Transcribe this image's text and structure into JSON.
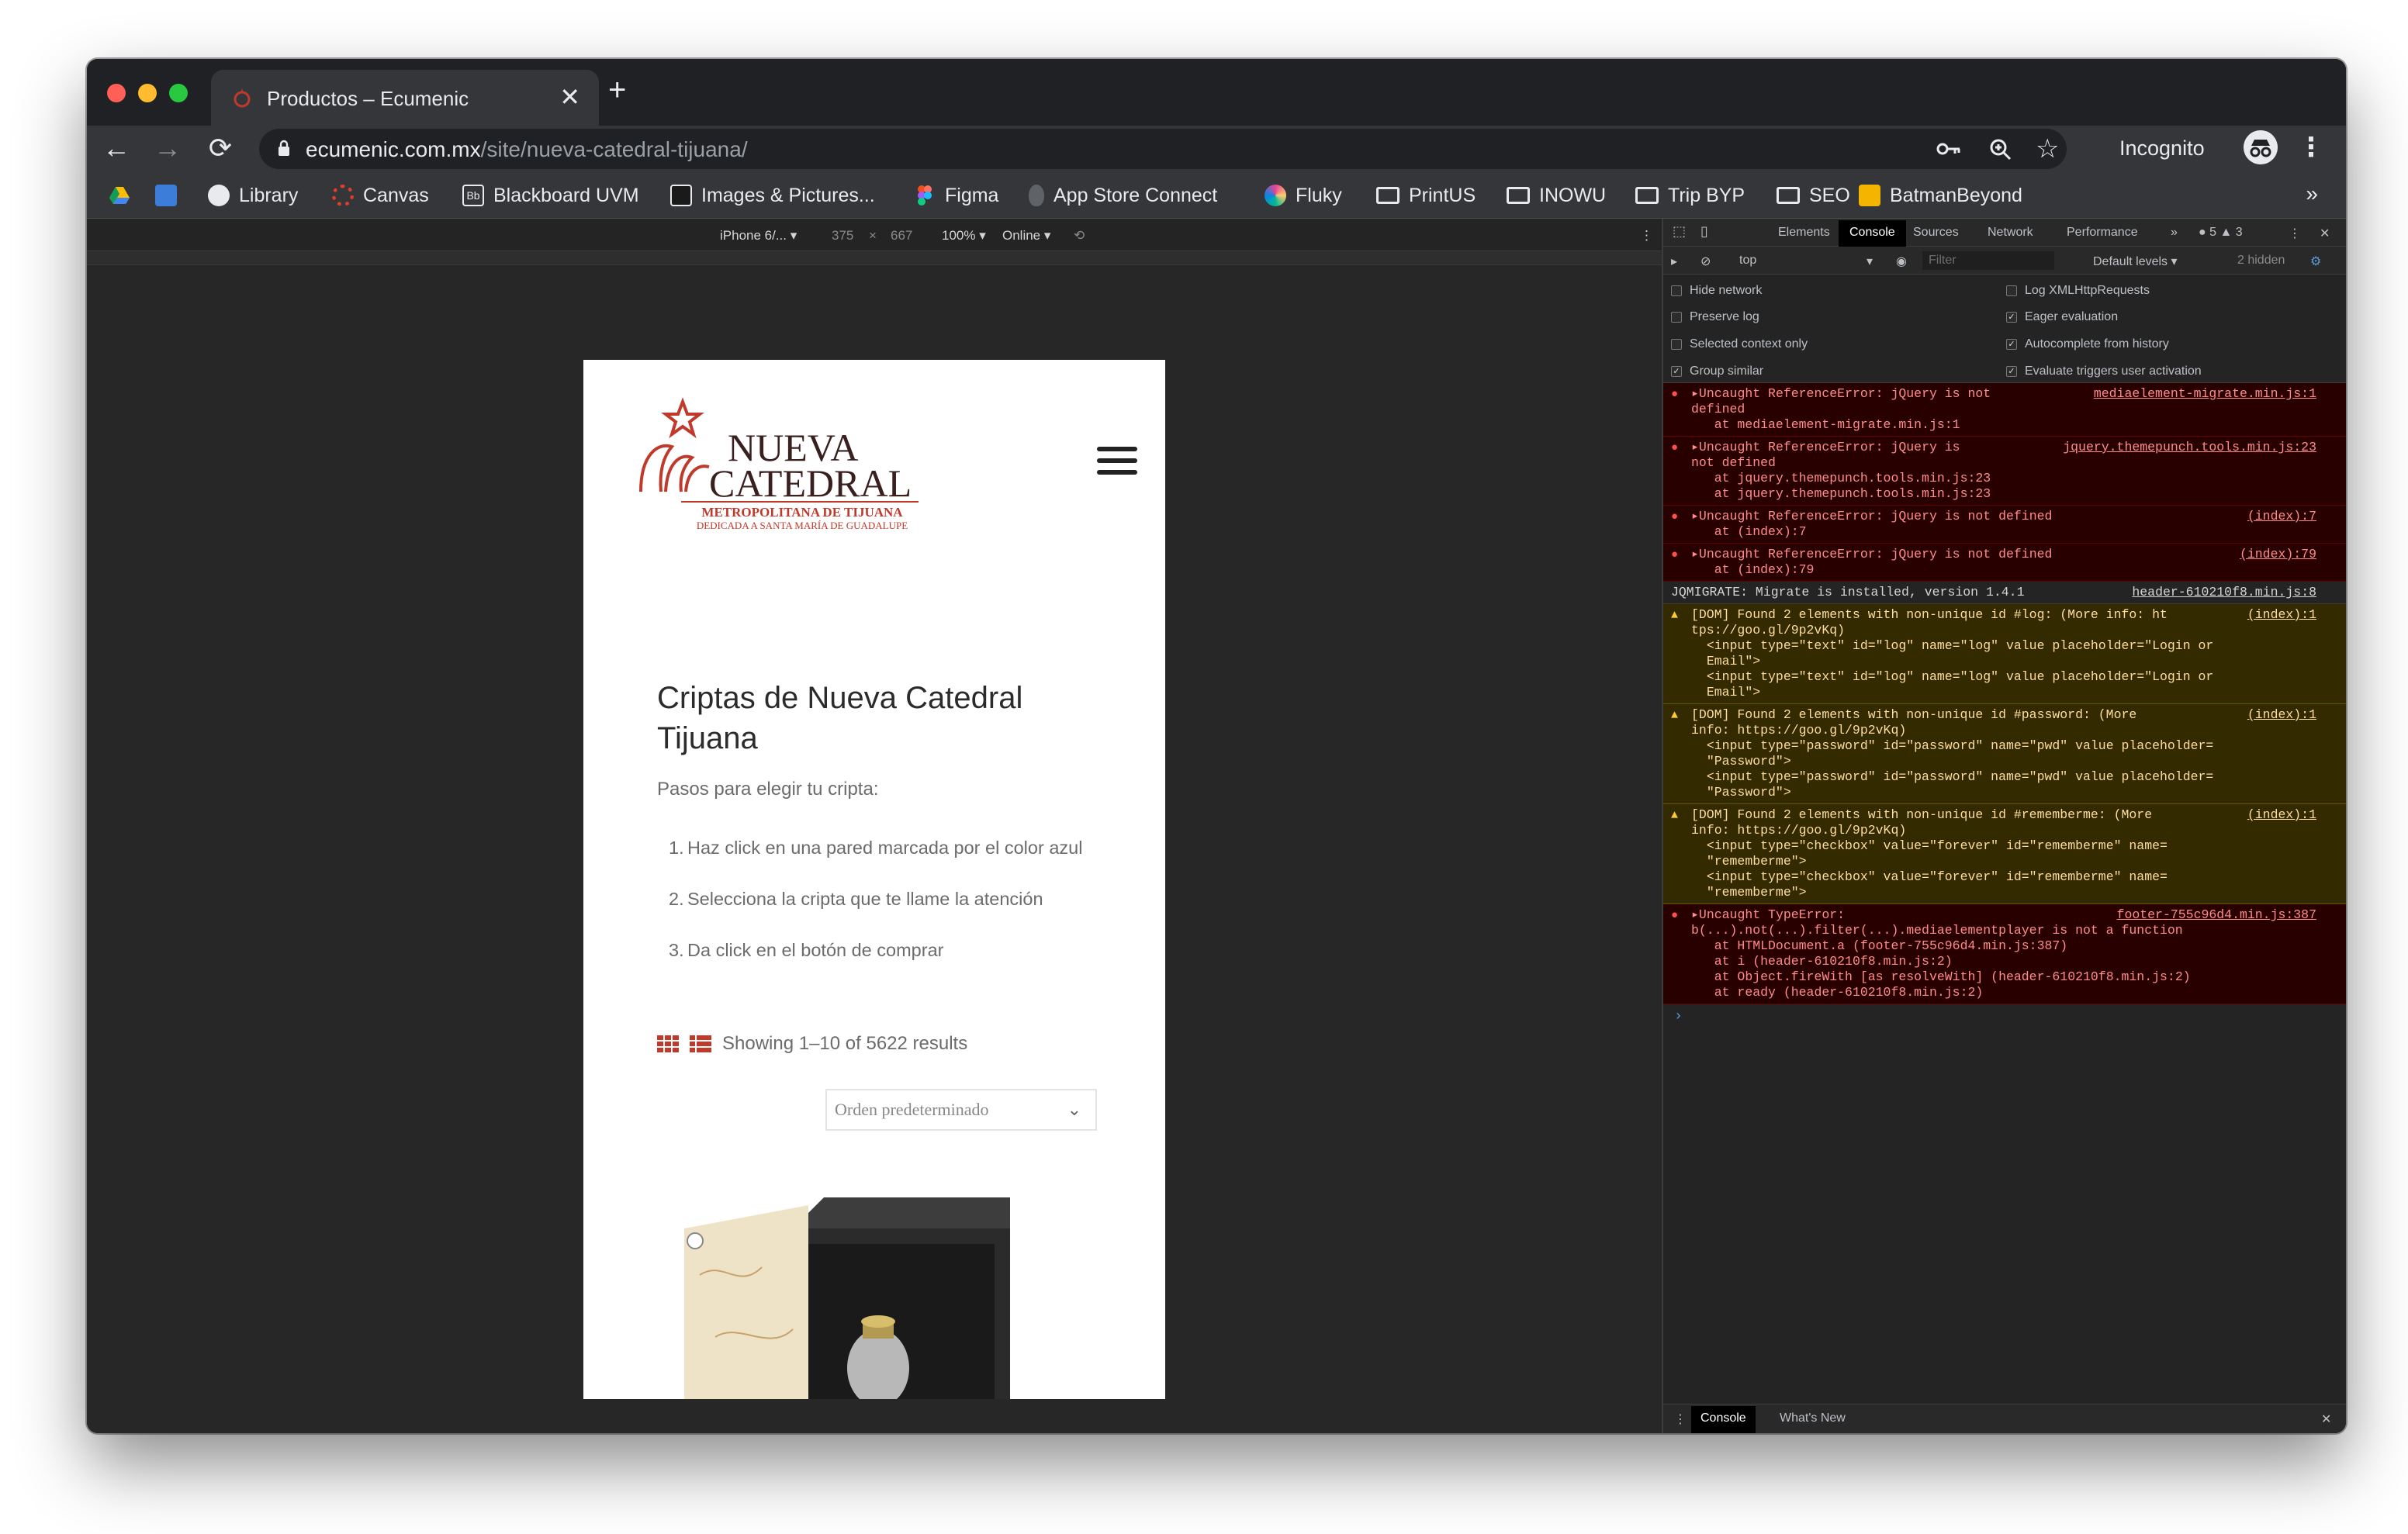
{
  "browser": {
    "tab": {
      "title": "Productos – Ecumenic",
      "close": "✕"
    },
    "new_tab": "+",
    "url_host": "ecumenic.com.mx",
    "url_path": "/site/nueva-catedral-tijuana/",
    "incognito_label": "Incognito",
    "bookmarks": [
      {
        "label": "",
        "icon": "google-drive-icon"
      },
      {
        "label": "",
        "icon": "blue-app-icon"
      },
      {
        "label": "Library",
        "icon": "globe-icon"
      },
      {
        "label": "Canvas",
        "icon": "canvas-icon"
      },
      {
        "label": "Blackboard UVM",
        "icon": "blackboard-icon"
      },
      {
        "label": "Images & Pictures...",
        "icon": "images-icon"
      },
      {
        "label": "Figma",
        "icon": "figma-icon"
      },
      {
        "label": "App Store Connect",
        "icon": "apple-icon"
      },
      {
        "label": "Fluky",
        "icon": "fluky-icon"
      },
      {
        "label": "PrintUS",
        "icon": "folder-icon"
      },
      {
        "label": "INOWU",
        "icon": "folder-icon"
      },
      {
        "label": "Trip BYP",
        "icon": "folder-icon"
      },
      {
        "label": "SEO",
        "icon": "folder-icon"
      },
      {
        "label": "BatmanBeyond",
        "icon": "batman-icon"
      }
    ],
    "bookmarks_more": "»"
  },
  "device_toolbar": {
    "device": "iPhone 6/... ▾",
    "width": "375",
    "times": "×",
    "height": "667",
    "zoom": "100% ▾",
    "network": "Online ▾"
  },
  "page": {
    "logo_title": "NUEVA CATEDRAL",
    "logo_sub1": "METROPOLITANA DE TIJUANA",
    "logo_sub2": "DEDICADA A SANTA MARÍA DE GUADALUPE",
    "heading": "Criptas de Nueva Catedral Tijuana",
    "intro": "Pasos para elegir tu cripta:",
    "steps": [
      {
        "num": "1.",
        "text": "Haz click en una pared marcada por el color azul"
      },
      {
        "num": "2.",
        "text": "Selecciona la cripta que te llame la atención"
      },
      {
        "num": "3.",
        "text": "Da click en el botón de comprar"
      }
    ],
    "results": "Showing 1–10 of 5622 results",
    "sort_value": "Orden predeterminado",
    "sort_caret": "⌄"
  },
  "devtools": {
    "tabs": [
      "Elements",
      "Console",
      "Sources",
      "Network",
      "Performance"
    ],
    "more": "»",
    "counts": "● 5 ▲ 3",
    "context": "top",
    "filter_placeholder": "Filter",
    "levels": "Default levels ▾",
    "hidden": "2 hidden",
    "settings_left": [
      {
        "label": "Hide network",
        "checked": false
      },
      {
        "label": "Preserve log",
        "checked": false
      },
      {
        "label": "Selected context only",
        "checked": false
      },
      {
        "label": "Group similar",
        "checked": true
      }
    ],
    "settings_right": [
      {
        "label": "Log XMLHttpRequests",
        "checked": false
      },
      {
        "label": "Eager evaluation",
        "checked": true
      },
      {
        "label": "Autocomplete from history",
        "checked": true
      },
      {
        "label": "Evaluate triggers user activation",
        "checked": true
      }
    ],
    "log": [
      {
        "level": "err",
        "msg": "▸Uncaught ReferenceError: jQuery is not\ndefined\n   at mediaelement-migrate.min.js:1",
        "src": "mediaelement-migrate.min.js:1"
      },
      {
        "level": "err",
        "msg": "▸Uncaught ReferenceError: jQuery is\nnot defined\n   at jquery.themepunch.tools.min.js:23\n   at jquery.themepunch.tools.min.js:23",
        "src": "jquery.themepunch.tools.min.js:23"
      },
      {
        "level": "err",
        "msg": "▸Uncaught ReferenceError: jQuery is not defined\n   at (index):7",
        "src": "(index):7"
      },
      {
        "level": "err",
        "msg": "▸Uncaught ReferenceError: jQuery is not defined\n   at (index):79",
        "src": "(index):79"
      },
      {
        "level": "info",
        "msg": "JQMIGRATE: Migrate is installed, version 1.4.1",
        "src": "header-610210f8.min.js:8"
      },
      {
        "level": "warn",
        "msg": "[DOM] Found 2 elements with non-unique id #log: (More info: ht\ntps://goo.gl/9p2vKq)\n  <input type=\"text\" id=\"log\" name=\"log\" value placeholder=\"Login or\n  Email\">\n  <input type=\"text\" id=\"log\" name=\"log\" value placeholder=\"Login or\n  Email\">",
        "src": "(index):1"
      },
      {
        "level": "warn",
        "msg": "[DOM] Found 2 elements with non-unique id #password: (More\ninfo: https://goo.gl/9p2vKq)\n  <input type=\"password\" id=\"password\" name=\"pwd\" value placeholder=\n  \"Password\">\n  <input type=\"password\" id=\"password\" name=\"pwd\" value placeholder=\n  \"Password\">",
        "src": "(index):1"
      },
      {
        "level": "warn",
        "msg": "[DOM] Found 2 elements with non-unique id #rememberme: (More\ninfo: https://goo.gl/9p2vKq)\n  <input type=\"checkbox\" value=\"forever\" id=\"rememberme\" name=\n  \"rememberme\">\n  <input type=\"checkbox\" value=\"forever\" id=\"rememberme\" name=\n  \"rememberme\">",
        "src": "(index):1"
      },
      {
        "level": "err",
        "msg": "▸Uncaught TypeError:\nb(...).not(...).filter(...).mediaelementplayer is not a function\n   at HTMLDocument.a (footer-755c96d4.min.js:387)\n   at i (header-610210f8.min.js:2)\n   at Object.fireWith [as resolveWith] (header-610210f8.min.js:2)\n   at ready (header-610210f8.min.js:2)",
        "src": "footer-755c96d4.min.js:387"
      }
    ],
    "prompt": "›",
    "drawer_tabs": [
      "Console",
      "What's New"
    ],
    "drawer_close": "✕"
  }
}
